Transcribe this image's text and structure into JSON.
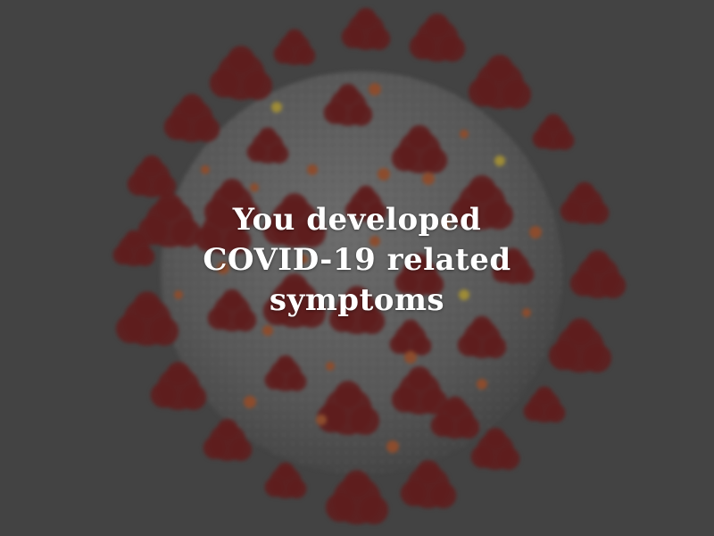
{
  "screen": {
    "message_lines": [
      "You developed",
      "COVID-19 related",
      "symptoms"
    ]
  },
  "colors": {
    "background": "#4a4a4a",
    "virus_body": "#6e6e6e",
    "spike_protein": "#6b1c1c",
    "small_protein": "#a3552f",
    "highlight": "#b9a23a",
    "text": "#ffffff"
  },
  "illustration": {
    "subject": "coronavirus-particle"
  }
}
